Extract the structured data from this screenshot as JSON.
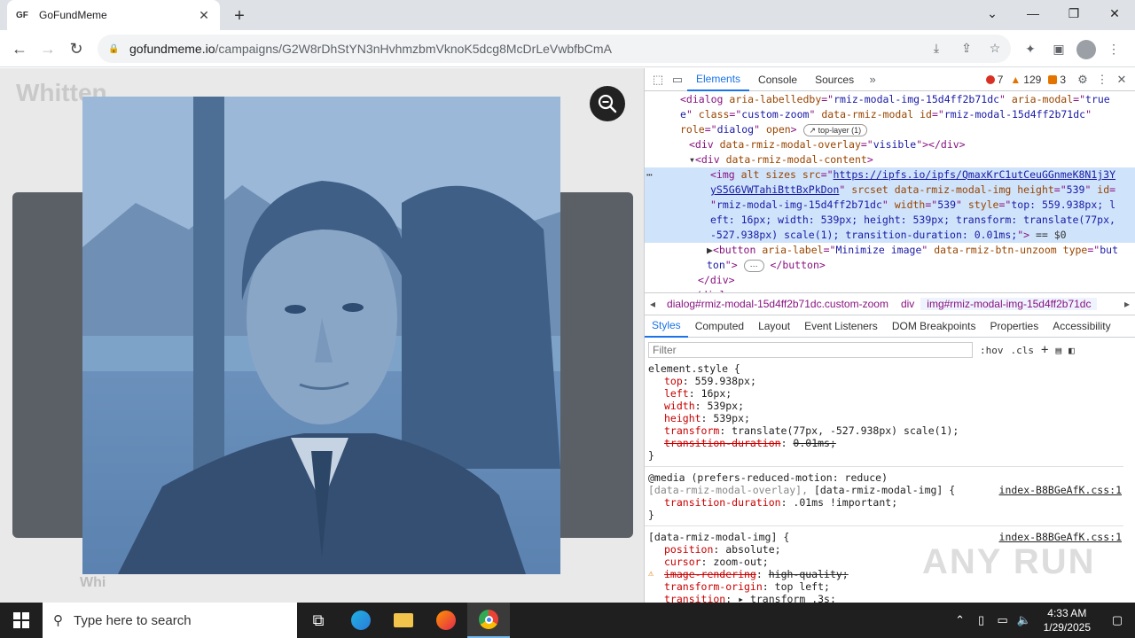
{
  "browser": {
    "tab_title": "GoFundMeme",
    "favicon_text": "GF",
    "url_host": "gofundmeme.io",
    "url_path": "/campaigns/G2W8rDhStYN3nHvhmzbmVknoK5dcg8McDrLeVwbfbCmA"
  },
  "page": {
    "bg_title": "Whitten",
    "bg_foot": "Whi"
  },
  "devtools": {
    "tabs": [
      "Elements",
      "Console",
      "Sources"
    ],
    "errors": "7",
    "warnings": "129",
    "issues": "3",
    "elements_lines": [
      {
        "indent": 4,
        "html": "&lt;dialog <span class='attr'>aria-labelledby</span>=\"<span class='val'>rmiz-modal-img-15d4ff2b71dc</span>\" <span class='attr'>aria-modal</span>=\"<span class='val'>true</span>"
      },
      {
        "indent": 4,
        "html": "<span class='val'>e</span>\" <span class='attr'>class</span>=\"<span class='val'>custom-zoom</span>\" <span class='attr'>data-rmiz-modal</span> <span class='attr'>id</span>=\"<span class='val'>rmiz-modal-15d4ff2b71dc</span>\""
      },
      {
        "indent": 4,
        "html": "<span class='attr'>role</span>=\"<span class='val'>dialog</span>\" <span class='attr'>open</span>&gt; <span class='top-layer'>↗ top-layer (1)</span>"
      },
      {
        "indent": 5,
        "html": "&lt;div <span class='attr'>data-rmiz-modal-overlay</span>=\"<span class='val'>visible</span>\"&gt;&lt;/div&gt;"
      },
      {
        "indent": 5,
        "html": "<span class='txt'>▾</span>&lt;div <span class='attr'>data-rmiz-modal-content</span>&gt;"
      }
    ],
    "selected_lines": [
      "&lt;img <span class='attr'>alt</span> <span class='attr'>sizes</span> <span class='attr'>src</span>=\"<span class='el-link'>https://ipfs.io/ipfs/QmaxKrC1utCeuGGnmeK8N1j3Y</span>",
      "<span class='el-link'>yS5G6VWTahiBttBxPkDon</span>\" <span class='attr'>srcset</span> <span class='attr'>data-rmiz-modal-img</span> <span class='attr'>height</span>=\"<span class='val'>539</span>\" <span class='attr'>id</span>=",
      "\"<span class='val'>rmiz-modal-img-15d4ff2b71dc</span>\" <span class='attr'>width</span>=\"<span class='val'>539</span>\" <span class='attr'>style</span>=\"<span class='val'>top: 559.938px; l</span>",
      "<span class='val'>eft: 16px; width: 539px; height: 539px; transform: translate(77px,</span>",
      "<span class='val'>-527.938px) scale(1); transition-duration: 0.01ms;</span>\"&gt; <span class='txt'>== $0</span>"
    ],
    "after_lines": [
      {
        "indent": 7,
        "html": "<span class='txt'>▶</span>&lt;button <span class='attr'>aria-label</span>=\"<span class='val'>Minimize image</span>\" <span class='attr'>data-rmiz-btn-unzoom</span> <span class='attr'>type</span>=\"<span class='val'>but</span>"
      },
      {
        "indent": 7,
        "html": "<span class='val'>ton</span>\"&gt; <span class='top-layer'>⋯</span> &lt;/button&gt;"
      },
      {
        "indent": 6,
        "html": "&lt;/div&gt;"
      },
      {
        "indent": 5,
        "html": "&lt;/dialog&gt;"
      }
    ],
    "crumbs": [
      "dialog#rmiz-modal-15d4ff2b71dc.custom-zoom",
      "div",
      "img#rmiz-modal-img-15d4ff2b71dc"
    ],
    "sub_tabs": [
      "Styles",
      "Computed",
      "Layout",
      "Event Listeners",
      "DOM Breakpoints",
      "Properties",
      "Accessibility"
    ],
    "filter_placeholder": "Filter",
    "hov": ":hov",
    "cls": ".cls",
    "styles": {
      "element_style": "element.style {",
      "props": [
        {
          "name": "top",
          "value": "559.938px;",
          "struck": false
        },
        {
          "name": "left",
          "value": "16px;",
          "struck": false
        },
        {
          "name": "width",
          "value": "539px;",
          "struck": false
        },
        {
          "name": "height",
          "value": "539px;",
          "struck": false
        },
        {
          "name": "transform",
          "value": "translate(77px, -527.938px) scale(1);",
          "struck": false
        },
        {
          "name": "transition-duration",
          "value": "0.01ms;",
          "struck": true
        }
      ],
      "media": "@media (prefers-reduced-motion: reduce)",
      "rule2_selector_muted": "[data-rmiz-modal-overlay],",
      "rule2_selector": " [data-rmiz-modal-img] {",
      "rule2_src": "index-B8BGeAfK.css:1",
      "rule2_prop": "transition-duration",
      "rule2_val": ".01ms !important;",
      "rule3_selector": "[data-rmiz-modal-img] {",
      "rule3_src": "index-B8BGeAfK.css:1",
      "rule3_props": [
        {
          "name": "position",
          "value": "absolute;",
          "struck": false,
          "warn": false
        },
        {
          "name": "cursor",
          "value": "zoom-out;",
          "struck": false,
          "warn": false
        },
        {
          "name": "image-rendering",
          "value": "high-quality;",
          "struck": true,
          "warn": true
        },
        {
          "name": "transform-origin",
          "value": "top left;",
          "struck": false,
          "warn": false
        },
        {
          "name": "transition",
          "value": "▸ transform .3s;",
          "struck": false,
          "warn": false
        }
      ],
      "close": "}"
    }
  },
  "watermark": "ANY RUN",
  "taskbar": {
    "search_placeholder": "Type here to search",
    "time": "4:33 AM",
    "date": "1/29/2025"
  }
}
